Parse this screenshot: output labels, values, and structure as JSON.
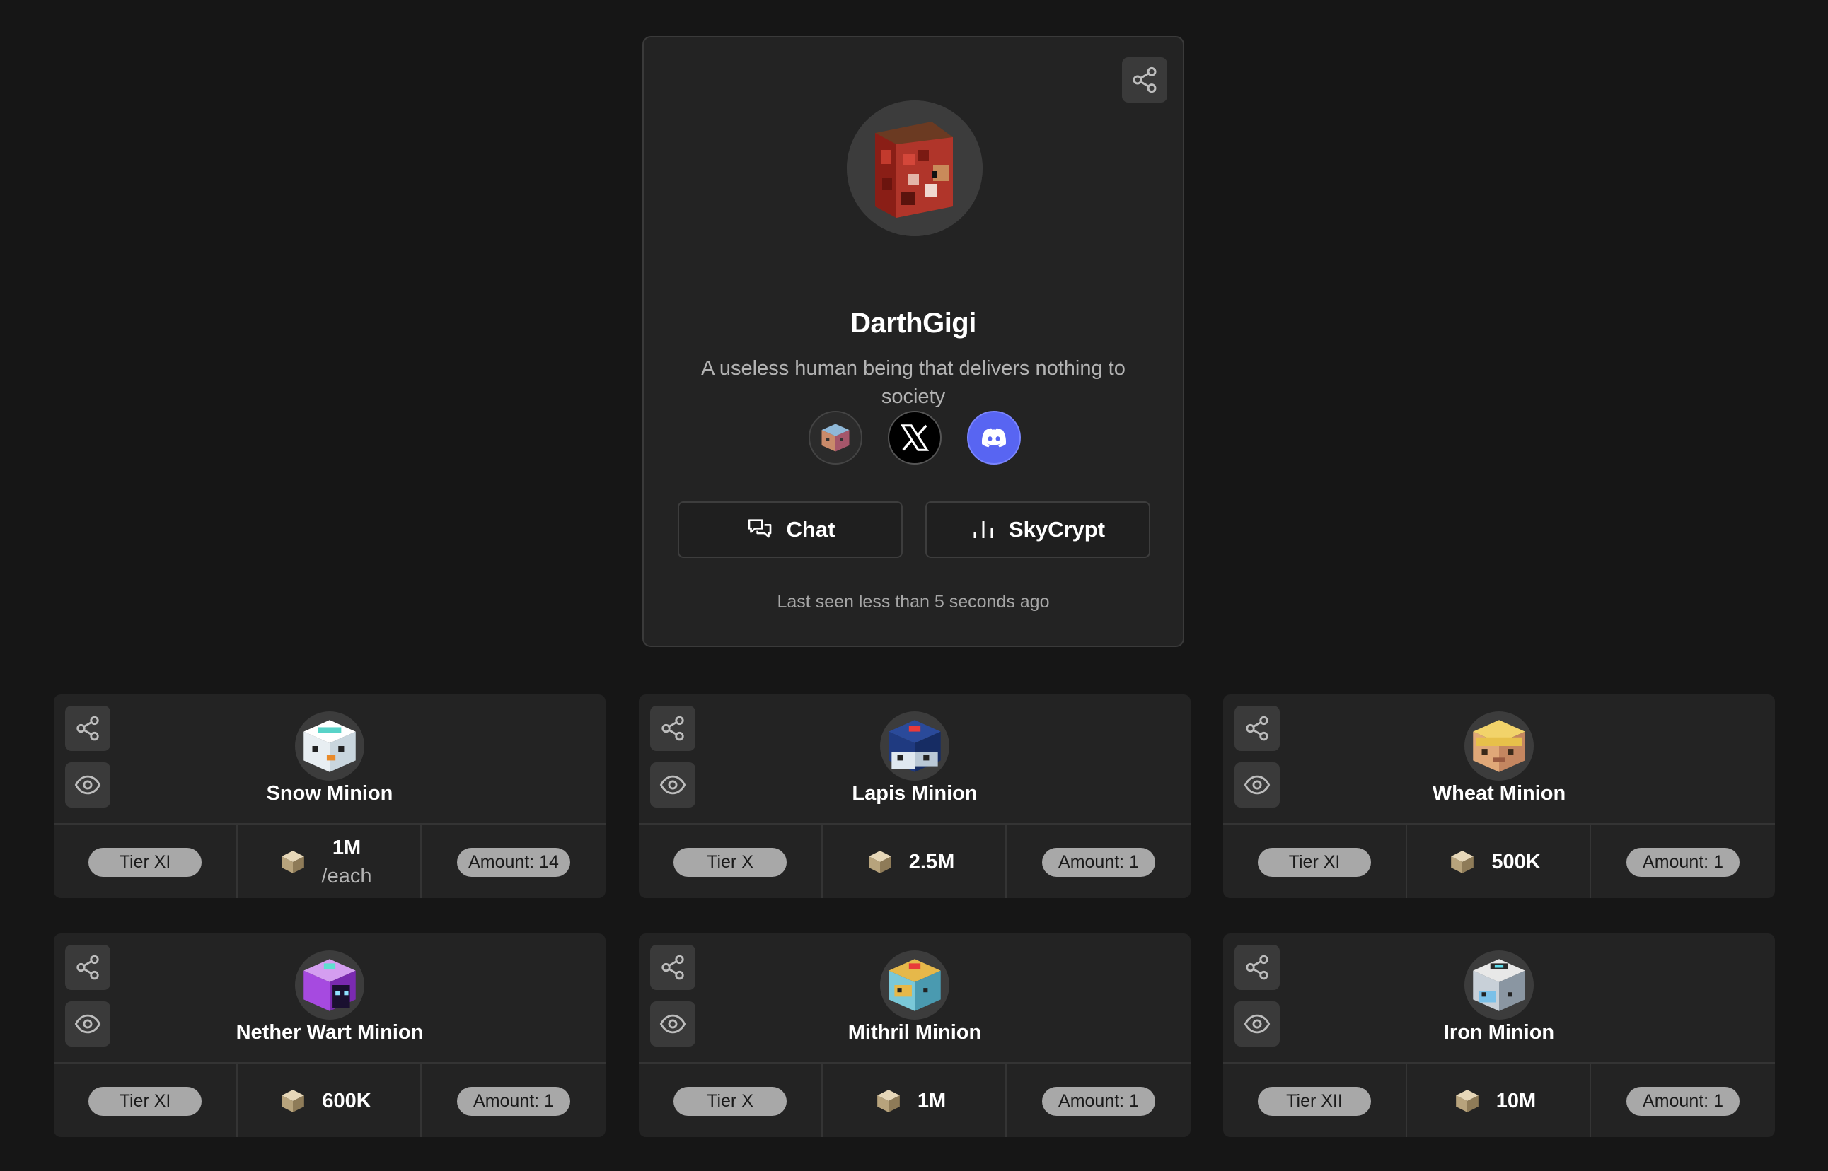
{
  "profile": {
    "name": "DarthGigi",
    "bio": "A useless human being that delivers nothing to society",
    "socials": [
      "minecraft-head-icon",
      "x-icon",
      "discord-icon"
    ],
    "chat_label": "Chat",
    "skycrypt_label": "SkyCrypt",
    "last_seen": "Last seen less than 5 seconds ago"
  },
  "minions": [
    {
      "name": "Snow Minion",
      "tier": "Tier XI",
      "price": "1M",
      "price_unit": "/each",
      "amount": "Amount: 14",
      "icon": "snow-minion-icon"
    },
    {
      "name": "Lapis Minion",
      "tier": "Tier X",
      "price": "2.5M",
      "price_unit": "",
      "amount": "Amount: 1",
      "icon": "lapis-minion-icon"
    },
    {
      "name": "Wheat Minion",
      "tier": "Tier XI",
      "price": "500K",
      "price_unit": "",
      "amount": "Amount: 1",
      "icon": "wheat-minion-icon"
    },
    {
      "name": "Nether Wart Minion",
      "tier": "Tier XI",
      "price": "600K",
      "price_unit": "",
      "amount": "Amount: 1",
      "icon": "nether-wart-minion-icon"
    },
    {
      "name": "Mithril Minion",
      "tier": "Tier X",
      "price": "1M",
      "price_unit": "",
      "amount": "Amount: 1",
      "icon": "mithril-minion-icon"
    },
    {
      "name": "Iron Minion",
      "tier": "Tier XII",
      "price": "10M",
      "price_unit": "",
      "amount": "Amount: 1",
      "icon": "iron-minion-icon"
    }
  ],
  "colors": {
    "background": "#161616",
    "card": "#232323",
    "discord": "#5865f2",
    "pill": "#a8a8a8"
  }
}
